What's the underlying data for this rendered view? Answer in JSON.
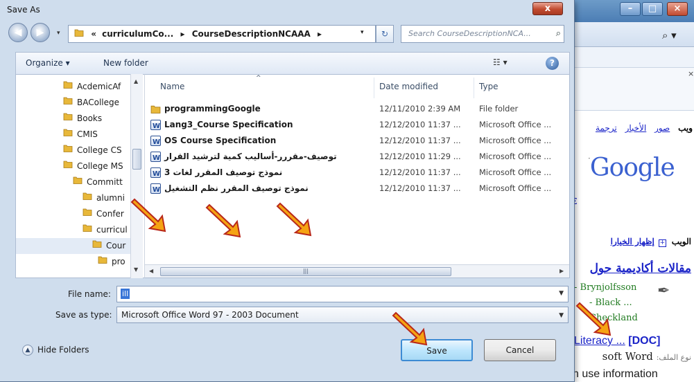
{
  "dialog": {
    "title": "Save As",
    "close_label": "x",
    "address": {
      "prefix": "«",
      "crumbs": [
        "curriculumCo...",
        "CourseDescriptionNCAAA"
      ],
      "separator": "▸"
    },
    "search_placeholder": "Search CourseDescriptionNCA...",
    "toolbar": {
      "organize_label": "Organize ▾",
      "new_folder_label": "New folder",
      "help_label": "?"
    },
    "nav_tree": [
      {
        "label": "AcdemicAf",
        "indent": 0
      },
      {
        "label": "BACollege",
        "indent": 0
      },
      {
        "label": "Books",
        "indent": 0
      },
      {
        "label": "CMIS",
        "indent": 0
      },
      {
        "label": "College CS",
        "indent": 0
      },
      {
        "label": "College MS",
        "indent": 0
      },
      {
        "label": "Committ",
        "indent": 1
      },
      {
        "label": "alumni",
        "indent": 2
      },
      {
        "label": "Confer",
        "indent": 2
      },
      {
        "label": "curricul",
        "indent": 2
      },
      {
        "label": "Cour",
        "indent": 3,
        "selected": true
      },
      {
        "label": "pro",
        "indent": 4
      }
    ],
    "columns": {
      "name": "Name",
      "date": "Date modified",
      "type": "Type"
    },
    "files": [
      {
        "name": "programmingGoogle",
        "date": "12/11/2010 2:39 AM",
        "type": "File folder",
        "icon": "folder-icon"
      },
      {
        "name": "Lang3_Course Specification",
        "date": "12/12/2010 11:37 ...",
        "type": "Microsoft Office ...",
        "icon": "word-doc-icon"
      },
      {
        "name": "OS Course Specification",
        "date": "12/12/2010 11:37 ...",
        "type": "Microsoft Office ...",
        "icon": "word-doc-icon"
      },
      {
        "name": "توصيف-مقررر-أساليب كمية لترشيد القرار",
        "date": "12/12/2010 11:29 ...",
        "type": "Microsoft Office ...",
        "icon": "word-doc-icon",
        "rtl": true
      },
      {
        "name": "نموذج توصيف المقرر لغات 3",
        "date": "12/12/2010 11:37 ...",
        "type": "Microsoft Office ...",
        "icon": "word-doc-icon",
        "rtl": true
      },
      {
        "name": "نموذج توصيف المقرر نظم التشغيل",
        "date": "12/12/2010 11:37 ...",
        "type": "Microsoft Office ...",
        "icon": "word-doc-icon",
        "rtl": true
      }
    ],
    "file_name_label": "File name:",
    "file_name_value": "ill",
    "save_as_type_label": "Save as type:",
    "save_as_type_value": "Microsoft Office Word 97 - 2003 Document",
    "hide_folders_label": "Hide Folders",
    "save_label": "Save",
    "cancel_label": "Cancel"
  },
  "background": {
    "nav_links": [
      "ويب",
      "صور",
      "الأخبار",
      "ترجمة"
    ],
    "logo_text": "Google",
    "web_label": "الويب",
    "show_options_label": "إظهار الخيارا",
    "result_title": "مقالات أكاديمية حول",
    "citations": [
      "- Brynjolfsson",
      "- Black ...",
      "Checkland"
    ],
    "doc_link": "Literacy ...",
    "doc_tag": "[DOC]",
    "filetype_label": "نوع الملف:",
    "filetype_value": "soft Word",
    "last_line": "n use information"
  },
  "colors": {
    "dialog_bg": "#cfdded",
    "accent_blue": "#3875d7",
    "annotation_arrow": "#f5a313",
    "link_blue": "#1a23c8"
  }
}
